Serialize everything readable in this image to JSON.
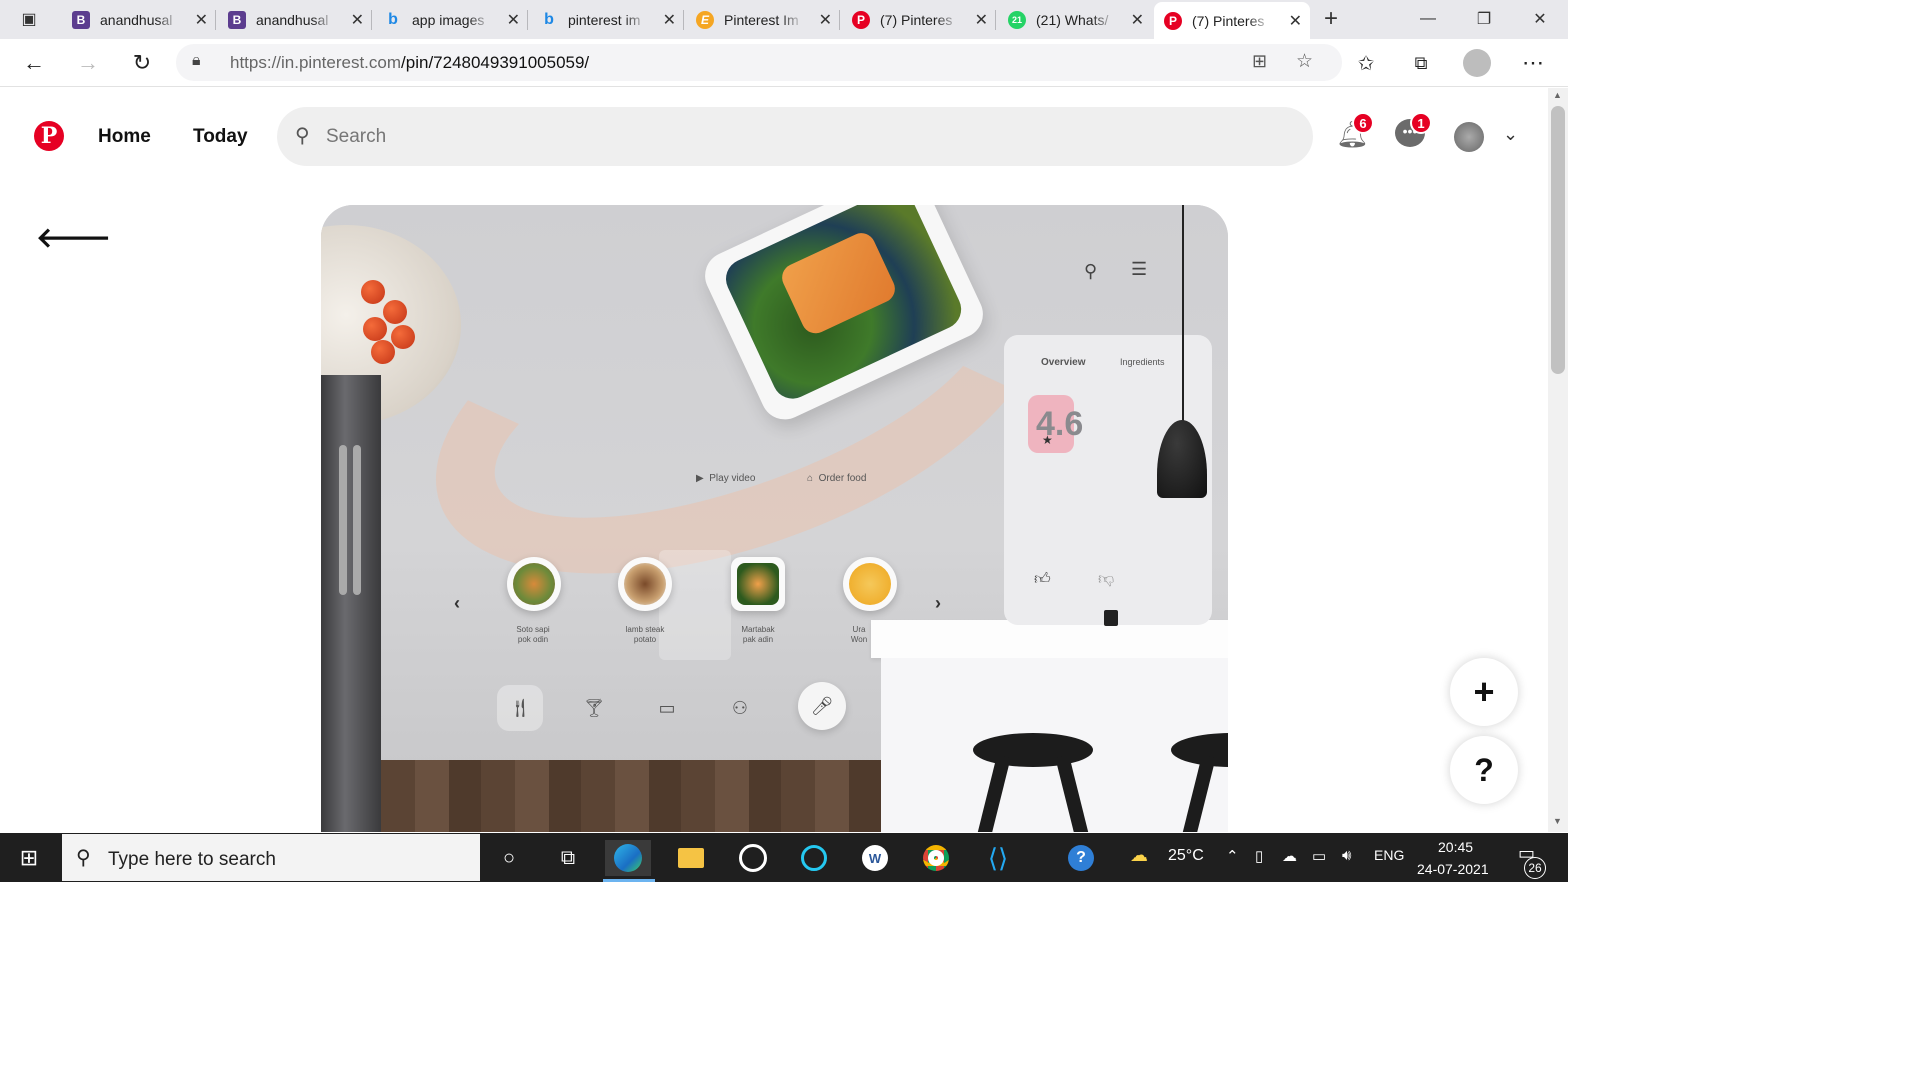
{
  "browser": {
    "tabs": [
      {
        "title": "anandhusal",
        "favicon": "B",
        "color": "#5c3d8f"
      },
      {
        "title": "anandhusal",
        "favicon": "B",
        "color": "#5c3d8f"
      },
      {
        "title": "app images",
        "favicon": "bing",
        "color": "#1e88e5"
      },
      {
        "title": "pinterest im",
        "favicon": "bing",
        "color": "#1e88e5"
      },
      {
        "title": "Pinterest Im",
        "favicon": "E",
        "color": "#f5a623"
      },
      {
        "title": "(7) Pinteres",
        "favicon": "P",
        "color": "#e60023"
      },
      {
        "title": "(21) Whats/",
        "favicon": "21",
        "color": "#25d366"
      },
      {
        "title": "(7) Pinteres",
        "favicon": "P",
        "color": "#e60023"
      }
    ],
    "url_host": "https://in.pinterest.com",
    "url_path": "/pin/7248049391005059/"
  },
  "pinterest": {
    "nav_home": "Home",
    "nav_today": "Today",
    "search_placeholder": "Search",
    "notifications_count": "6",
    "messages_count": "1",
    "accent": "#e60023"
  },
  "pin": {
    "tab_overview": "Overview",
    "tab_ingredients": "Ingredients",
    "rating": "4.6",
    "play_video": "Play video",
    "order_food": "Order food",
    "foods": [
      {
        "line1": "Soto sapi",
        "line2": "pok odin"
      },
      {
        "line1": "lamb steak",
        "line2": "potato"
      },
      {
        "line1": "Martabak",
        "line2": "pak adin"
      },
      {
        "line1": "Ura",
        "line2": "Won"
      }
    ]
  },
  "fab": {
    "add": "+",
    "help": "?"
  },
  "taskbar": {
    "search_placeholder": "Type here to search",
    "temperature": "25°C",
    "language": "ENG",
    "time": "20:45",
    "date": "24-07-2021",
    "notifications": "26"
  }
}
